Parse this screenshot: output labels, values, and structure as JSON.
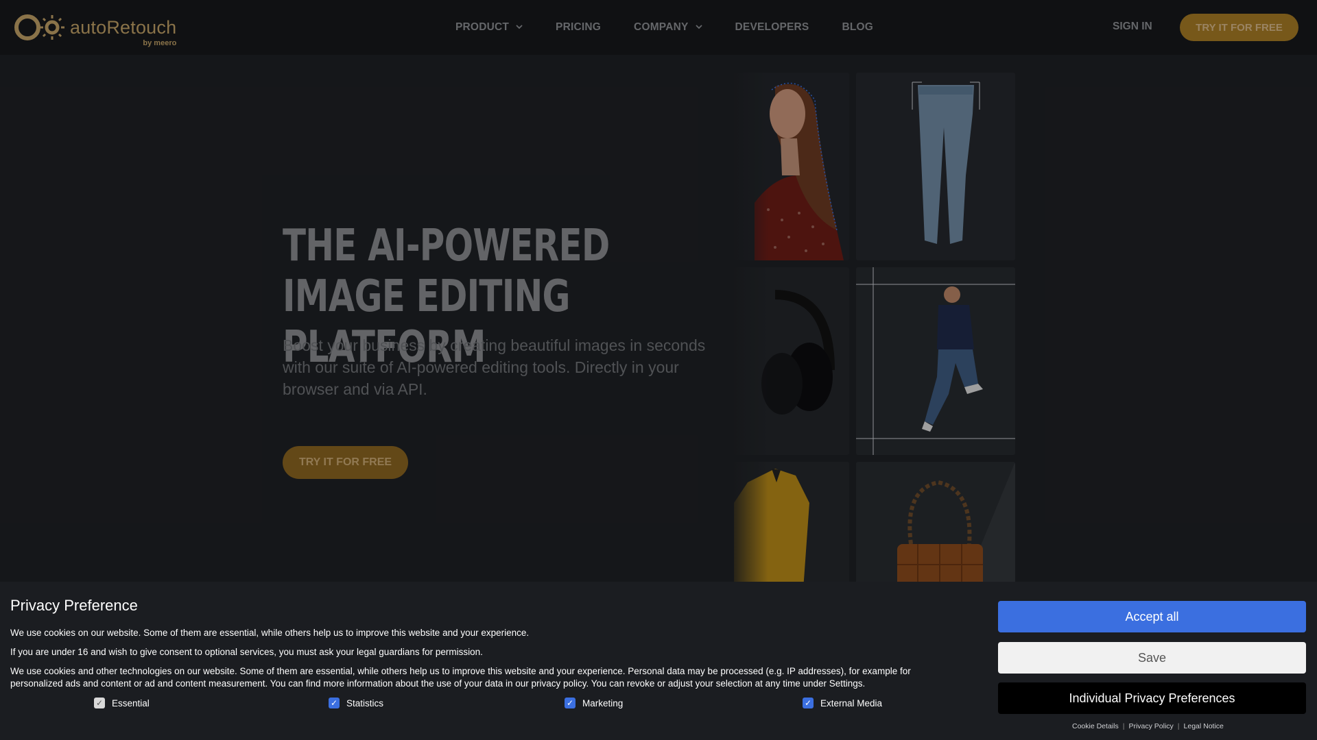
{
  "header": {
    "logo_text": "autoRetouch",
    "logo_by": "by meero",
    "nav": [
      {
        "label": "PRODUCT",
        "has_dropdown": true
      },
      {
        "label": "PRICING",
        "has_dropdown": false
      },
      {
        "label": "COMPANY",
        "has_dropdown": true
      },
      {
        "label": "DEVELOPERS",
        "has_dropdown": false
      },
      {
        "label": "BLOG",
        "has_dropdown": false
      }
    ],
    "sign_in": "SIGN IN",
    "try_free": "TRY IT FOR FREE"
  },
  "hero": {
    "title": "THE AI-POWERED IMAGE EDITING PLATFORM",
    "subtitle": "Boost your business by creating beautiful images in seconds with our suite of AI-powered editing tools. Directly in your browser and via API.",
    "cta": "TRY IT FOR FREE"
  },
  "gallery": {
    "tiles": [
      "woman-red-blouse",
      "jeans",
      "headphones",
      "man-jumping",
      "yellow-shirt",
      "brown-bag"
    ]
  },
  "cookie_banner": {
    "title": "Privacy Preference",
    "p1": "We use cookies on our website. Some of them are essential, while others help us to improve this website and your experience.",
    "p2": "If you are under 16 and wish to give consent to optional services, you must ask your legal guardians for permission.",
    "p3": "We use cookies and other technologies on our website. Some of them are essential, while others help us to improve this website and your experience. Personal data may be processed (e.g. IP addresses), for example for personalized ads and content or ad and content measurement. You can find more information about the use of your data in our privacy policy. You can revoke or adjust your selection at any time under Settings.",
    "options": [
      {
        "label": "Essential",
        "checked": true,
        "disabled": true
      },
      {
        "label": "Statistics",
        "checked": true,
        "disabled": false
      },
      {
        "label": "Marketing",
        "checked": true,
        "disabled": false
      },
      {
        "label": "External Media",
        "checked": true,
        "disabled": false
      }
    ],
    "accept_all": "Accept all",
    "save": "Save",
    "individual": "Individual Privacy Preferences",
    "links": [
      "Cookie Details",
      "Privacy Policy",
      "Legal Notice"
    ],
    "link_separator": "|"
  },
  "colors": {
    "accent_gold": "#a67a24",
    "accept_blue": "#3b6fe0",
    "checkbox_blue": "#3b6fe0"
  }
}
